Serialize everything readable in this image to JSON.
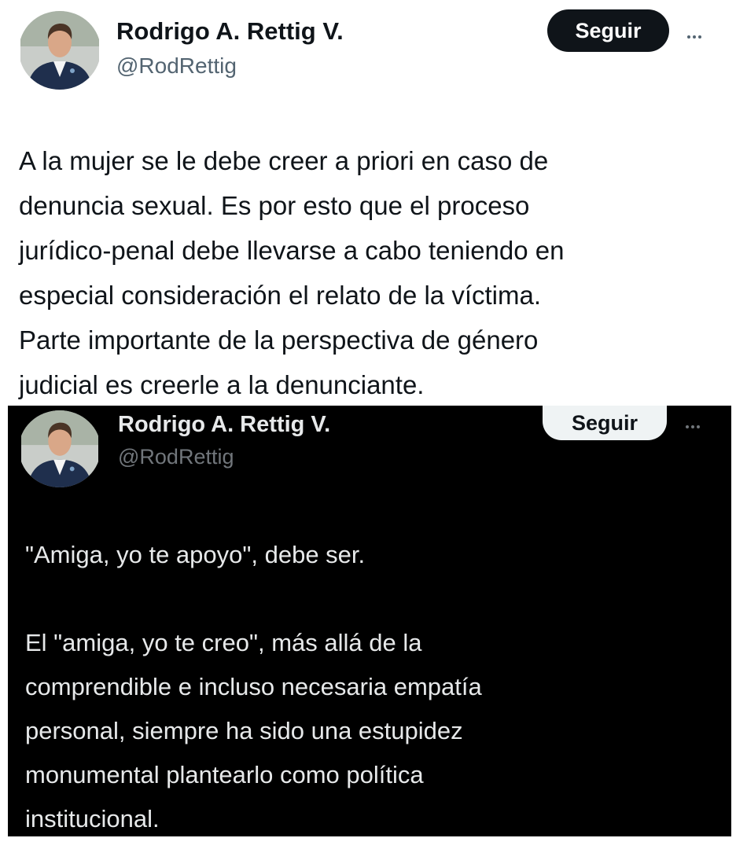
{
  "tweets": [
    {
      "display_name": "Rodrigo A. Rettig V.",
      "handle": "@RodRettig",
      "follow_label": "Seguir",
      "more_icon": "more-horizontal-icon",
      "text": "A la mujer se le debe creer a priori en caso de\ndenuncia sexual. Es por esto que el proceso\njurídico-penal debe llevarse a cabo teniendo en\nespecial consideración el relato de la víctima.\nParte importante de la perspectiva de género\njudicial es creerle a la denunciante.",
      "theme": "light"
    },
    {
      "display_name": "Rodrigo A. Rettig V.",
      "handle": "@RodRettig",
      "follow_label": "Seguir",
      "more_icon": "more-horizontal-icon",
      "text": "\"Amiga, yo te apoyo\", debe ser.\n\nEl \"amiga, yo te creo\", más allá de la\ncomprendible e incluso necesaria empatía\npersonal, siempre ha sido una estupidez\nmonumental plantearlo como política\ninstitucional.",
      "theme": "dark"
    }
  ],
  "colors": {
    "light_bg": "#ffffff",
    "dark_bg": "#000000",
    "light_text": "#0f1419",
    "dark_text": "#e7e9ea",
    "light_secondary": "#536471",
    "dark_secondary": "#71767b"
  }
}
